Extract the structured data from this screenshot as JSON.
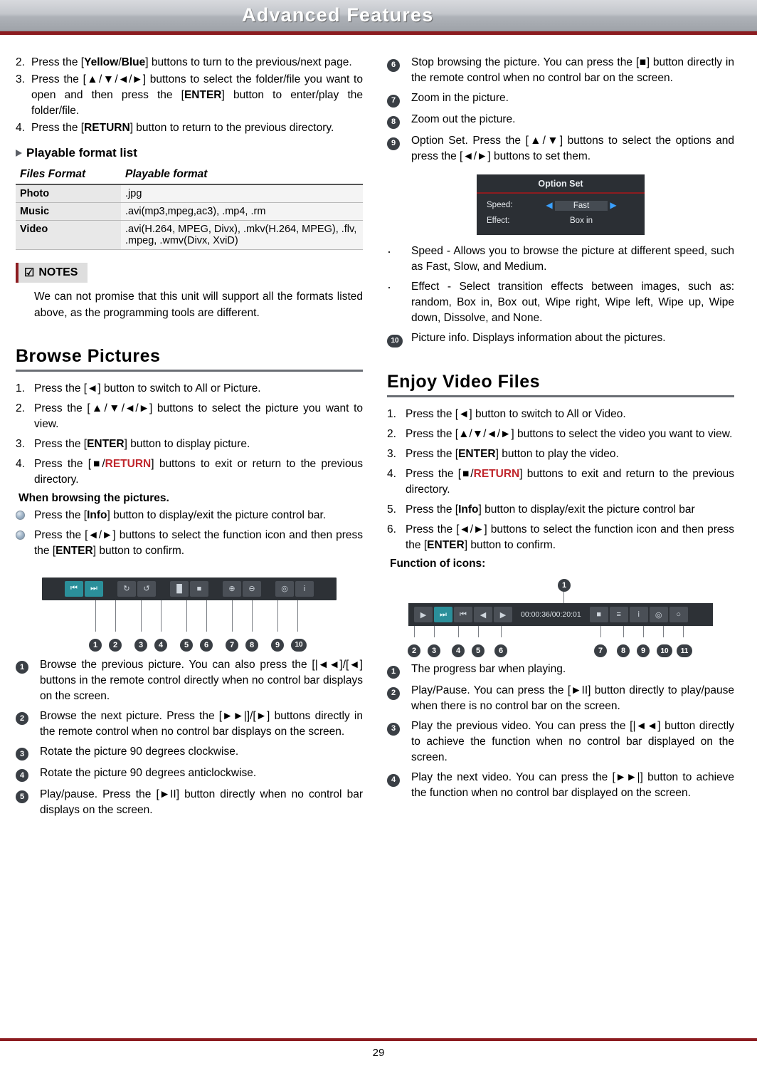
{
  "header": {
    "title": "Advanced Features"
  },
  "footer": {
    "page": "29"
  },
  "left": {
    "top_list": [
      {
        "num": "2.",
        "html": "Press the [<b>Yellow</b>/<b>Blue</b>] buttons to turn to the previous/next page."
      },
      {
        "num": "3.",
        "html": "Press the [▲/▼/◄/►] buttons to select the folder/file you want to open and then press the [<b>ENTER</b>] button to enter/play the folder/file."
      },
      {
        "num": "4.",
        "html": "Press the [<b>RETURN</b>] button to return to the previous directory."
      }
    ],
    "playable_heading": "Playable format list",
    "table": {
      "headers": [
        "Files Format",
        "Playable format"
      ],
      "rows": [
        [
          "Photo",
          ".jpg"
        ],
        [
          "Music",
          ".avi(mp3,mpeg,ac3), .mp4, .rm"
        ],
        [
          "Video",
          ".avi(H.264, MPEG, Divx), .mkv(H.264, MPEG), .flv, .mpeg, .wmv(Divx, XviD)"
        ]
      ]
    },
    "notes_label": "NOTES",
    "notes_icon": "check-box-icon",
    "notes_text": "We can not promise that this unit will support all the formats listed above, as the programming tools are different.",
    "browse_heading": "Browse Pictures",
    "browse_list": [
      {
        "num": "1.",
        "html": "Press the [◄] button to switch to All or Picture."
      },
      {
        "num": "2.",
        "html": "Press the [▲/▼/◄/►] buttons to select the picture you want to view."
      },
      {
        "num": "3.",
        "html": "Press the [<b>ENTER</b>] button to display picture."
      },
      {
        "num": "4.",
        "html": "Press the [■/<span class='red'>RETURN</span>] buttons to exit or return to the previous directory."
      }
    ],
    "when_browsing": "When browsing the pictures.",
    "ball_items": [
      "Press the [<b>Info</b>] button to display/exit the picture control bar.",
      "Press the [◄/►] buttons to select the function icon and then press the [<b>ENTER</b>] button to confirm."
    ],
    "picture_bar": {
      "name": "picture-control-bar",
      "groups": [
        {
          "icons": [
            "prev-icon",
            "next-icon"
          ],
          "teal": [
            true,
            true
          ]
        },
        {
          "icons": [
            "rotate-cw-icon",
            "rotate-ccw-icon"
          ],
          "teal": [
            false,
            false
          ]
        },
        {
          "icons": [
            "pause-icon",
            "stop-icon"
          ],
          "teal": [
            false,
            false
          ]
        },
        {
          "icons": [
            "zoom-in-icon",
            "zoom-out-icon"
          ],
          "teal": [
            false,
            false
          ]
        },
        {
          "icons": [
            "option-set-icon",
            "info-icon"
          ],
          "teal": [
            false,
            false
          ]
        }
      ],
      "callouts": [
        "1",
        "2",
        "3",
        "4",
        "5",
        "6",
        "7",
        "8",
        "9",
        "10"
      ]
    },
    "icon_desc": [
      {
        "n": "1",
        "html": "Browse the previous picture. You can also press the [|◄◄]/[◄] buttons in the remote control directly when no control bar displays on the screen."
      },
      {
        "n": "2",
        "html": "Browse the next picture. Press the [►►|]/[►] buttons directly in the remote control when no control bar displays on the screen."
      },
      {
        "n": "3",
        "html": "Rotate the picture 90 degrees clockwise."
      },
      {
        "n": "4",
        "html": "Rotate the picture 90 degrees anticlockwise."
      },
      {
        "n": "5",
        "html": "Play/pause. Press the [►II] button directly when no control bar displays on the screen."
      }
    ]
  },
  "right": {
    "cont_desc": [
      {
        "n": "6",
        "html": "Stop browsing the picture. You can press the [■] button directly in the remote control when no control bar on the screen."
      },
      {
        "n": "7",
        "html": "Zoom in the picture."
      },
      {
        "n": "8",
        "html": "Zoom out the picture."
      },
      {
        "n": "9",
        "html": "Option Set. Press the [▲/▼] buttons to select the options and press the [◄/►] buttons to set them."
      }
    ],
    "option_set": {
      "title": "Option Set",
      "rows": [
        {
          "label": "Speed:",
          "value": "Fast",
          "arrows": true
        },
        {
          "label": "Effect:",
          "value": "Box in",
          "arrows": false
        }
      ]
    },
    "dot_items": [
      "Speed - Allows you to browse the picture at different speed, such as Fast, Slow, and Medium.",
      "Effect - Select transition effects between images, such as: random, Box in, Box out, Wipe right, Wipe left, Wipe up, Wipe down, Dissolve, and None."
    ],
    "item10": {
      "n": "10",
      "html": "Picture info. Displays information about the pictures."
    },
    "video_heading": "Enjoy Video Files",
    "video_list": [
      {
        "num": "1.",
        "html": "Press the [◄] button to switch to All or Video."
      },
      {
        "num": "2.",
        "html": "Press the [▲/▼/◄/►] buttons to select the video you want to view."
      },
      {
        "num": "3.",
        "html": "Press the [<b>ENTER</b>] button to play the video."
      },
      {
        "num": "4.",
        "html": "Press the [■/<span class='red'>RETURN</span>] buttons to exit and return to the previous directory."
      },
      {
        "num": "5.",
        "html": "Press the [<b>Info</b>] button to display/exit the picture control bar"
      },
      {
        "num": "6.",
        "html": "Press the [◄/►] buttons to select the function icon and then press the [<b>ENTER</b>] button to confirm."
      }
    ],
    "function_of_icons": "Function of icons:",
    "video_bar": {
      "name": "video-control-bar",
      "time": "00:00:36/00:20:01",
      "left_icons": [
        "play-icon",
        "next-track-icon",
        "prev-icon",
        "rewind-icon",
        "forward-icon"
      ],
      "right_icons": [
        "stop-icon",
        "subtitle-icon",
        "info-icon",
        "option-icon",
        "repeat-icon"
      ],
      "callouts_top": [
        "1"
      ],
      "callouts_bottom": [
        "2",
        "3",
        "4",
        "5",
        "6",
        "7",
        "8",
        "9",
        "10",
        "11"
      ]
    },
    "video_desc": [
      {
        "n": "1",
        "html": "The progress bar when playing."
      },
      {
        "n": "2",
        "html": "Play/Pause. You can press the [►II] button directly to play/pause when there is no control bar on the screen."
      },
      {
        "n": "3",
        "html": "Play the previous video. You can press the [|◄◄] button directly to achieve the function when no control bar displayed on the screen."
      },
      {
        "n": "4",
        "html": "Play the next video. You can press the [►►|] button to achieve the function when no control bar displayed on the screen."
      }
    ]
  }
}
